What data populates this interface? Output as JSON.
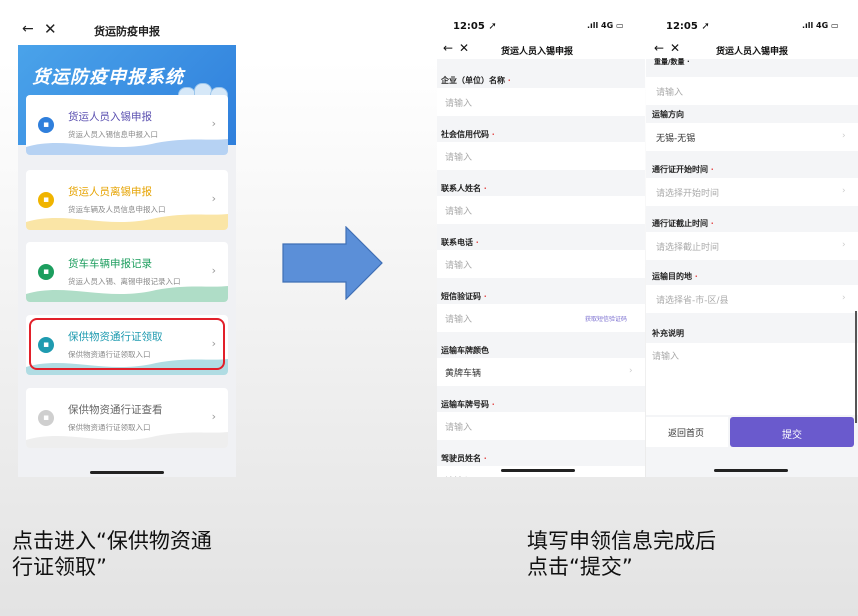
{
  "left_phone": {
    "nav": {
      "back": "←",
      "close": "✕",
      "title": "货运防疫申报"
    },
    "banner_title": "货运防疫申报系统",
    "cards": [
      {
        "title": "货运人员入锡申报",
        "subtitle": "货运人员入锡信息申报入口",
        "title_color": "#5a4fb0",
        "icon_color": "#2f7fdc",
        "icon": "id-card-icon"
      },
      {
        "title": "货运人员离锡申报",
        "subtitle": "货运车辆及人员信息申报入口",
        "title_color": "#e6a300",
        "icon_color": "#f0b400",
        "icon": "id-card-icon"
      },
      {
        "title": "货车车辆申报记录",
        "subtitle": "货运人员入锡、离锡申报记录入口",
        "title_color": "#1c9e5e",
        "icon_color": "#1c9e5e",
        "icon": "truck-icon"
      },
      {
        "title": "保供物资通行证领取",
        "subtitle": "保供物资通行证领取入口",
        "title_color": "#1f9bb0",
        "icon_color": "#1f9bb0",
        "icon": "pass-icon"
      },
      {
        "title": "保供物资通行证查看",
        "subtitle": "保供物资通行证领取入口",
        "title_color": "#666666",
        "icon_color": "#cfcfcf",
        "icon": "lock-icon"
      }
    ],
    "chevron": "›"
  },
  "form_phone_1": {
    "status_time": "12:05 ➚",
    "status_signal": ".ıll 4G ▭",
    "nav": {
      "back": "←",
      "close": "✕",
      "title": "货运人员入锡申报"
    },
    "fields": [
      {
        "label": "企业（单位）名称",
        "required": "·",
        "placeholder": "请输入"
      },
      {
        "label": "社会信用代码",
        "required": "·",
        "placeholder": "请输入"
      },
      {
        "label": "联系人姓名",
        "required": "·",
        "placeholder": "请输入"
      },
      {
        "label": "联系电话",
        "required": "·",
        "placeholder": "请输入"
      },
      {
        "label": "短信验证码",
        "required": "·",
        "placeholder": "请输入",
        "action": "获取短信验证码"
      },
      {
        "label": "运输车牌颜色",
        "required": "",
        "value": "黄牌车辆"
      },
      {
        "label": "运输车牌号码",
        "required": "·",
        "placeholder": "请输入"
      },
      {
        "label": "驾驶员姓名",
        "required": "·",
        "placeholder": "请输入"
      }
    ]
  },
  "form_phone_2": {
    "status_time": "12:05 ➚",
    "status_signal": ".ıll 4G ▭",
    "nav": {
      "back": "←",
      "close": "✕",
      "title": "货运人员入锡申报"
    },
    "top_cut_label": "重量/数量 ·",
    "fields": [
      {
        "label": "",
        "placeholder": "请输入"
      },
      {
        "label": "运输方向",
        "required": "",
        "value": "无锡-无锡"
      },
      {
        "label": "通行证开始时间",
        "required": "·",
        "placeholder": "请选择开始时间"
      },
      {
        "label": "通行证截止时间",
        "required": "·",
        "placeholder": "请选择截止时间"
      },
      {
        "label": "运输目的地",
        "required": "·",
        "placeholder": "请选择省-市-区/县"
      }
    ],
    "notes_label": "补充说明",
    "notes_placeholder": "请输入",
    "home_button": "返回首页",
    "submit_button": "提交",
    "submit_color": "#6a5acd"
  },
  "captions": {
    "left": [
      "点击进入“保供物资通",
      "行证领取”"
    ],
    "right": [
      "填写申领信息完成后",
      "点击“提交”"
    ]
  }
}
